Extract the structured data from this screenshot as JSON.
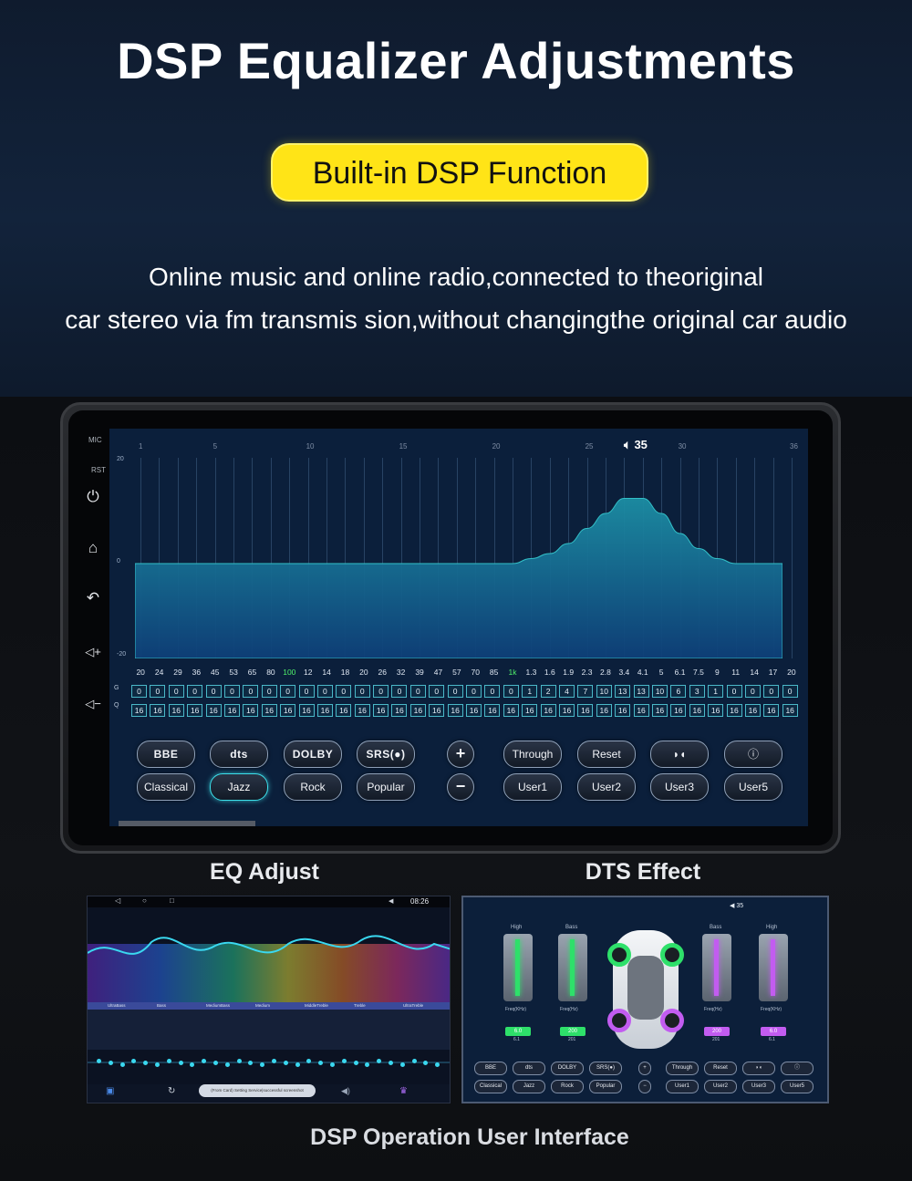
{
  "headline": "DSP Equalizer Adjustments",
  "pill": "Built-in DSP Function",
  "description": {
    "line1": "Online music and online radio,connected to theoriginal",
    "line2": "car stereo via fm transmis sion,without changingthe original car audio"
  },
  "tablet": {
    "side_labels": {
      "mic": "MIC",
      "rst": "RST"
    },
    "side_icons": [
      "power-icon",
      "home-icon",
      "back-icon",
      "volume-up-icon",
      "volume-down-icon"
    ],
    "volume": "35",
    "band_numbers": [
      "1",
      "5",
      "10",
      "15",
      "20",
      "25",
      "30",
      "36"
    ],
    "y_labels": [
      "20",
      "0",
      "-20"
    ],
    "row_labels": {
      "g": "G",
      "q": "Q"
    },
    "frequencies": [
      "20",
      "24",
      "29",
      "36",
      "45",
      "53",
      "65",
      "80",
      "100",
      "12",
      "14",
      "18",
      "20",
      "26",
      "32",
      "39",
      "47",
      "57",
      "70",
      "85",
      "1k",
      "1.3",
      "1.6",
      "1.9",
      "2.3",
      "2.8",
      "3.4",
      "4.1",
      "5",
      "6.1",
      "7.5",
      "9",
      "11",
      "14",
      "17",
      "20"
    ],
    "gains": [
      "0",
      "0",
      "0",
      "0",
      "0",
      "0",
      "0",
      "0",
      "0",
      "0",
      "0",
      "0",
      "0",
      "0",
      "0",
      "0",
      "0",
      "0",
      "0",
      "0",
      "0",
      "1",
      "2",
      "4",
      "7",
      "10",
      "13",
      "13",
      "10",
      "6",
      "3",
      "1",
      "0",
      "0",
      "0",
      "0"
    ],
    "q_values": [
      "16",
      "16",
      "16",
      "16",
      "16",
      "16",
      "16",
      "16",
      "16",
      "16",
      "16",
      "16",
      "16",
      "16",
      "16",
      "16",
      "16",
      "16",
      "16",
      "16",
      "16",
      "16",
      "16",
      "16",
      "16",
      "16",
      "16",
      "16",
      "16",
      "16",
      "16",
      "16",
      "16",
      "16",
      "16",
      "16"
    ],
    "buttons_row1": [
      "BBE",
      "dts",
      "DOLBY",
      "SRS(●)",
      "+",
      "Through",
      "Reset",
      "◗◖",
      "ⓘ"
    ],
    "buttons_row2": [
      "Classical",
      "Jazz",
      "Rock",
      "Popular",
      "−",
      "User1",
      "User2",
      "User3",
      "User5"
    ],
    "active_preset": "Jazz",
    "colors": {
      "accent": "#3de0ea",
      "curve_fill": "#1f8fa6",
      "screen_bg": "#0b1f3b"
    }
  },
  "captions": {
    "eq_adjust": "EQ Adjust",
    "dts_effect": "DTS Effect",
    "footer": "DSP Operation User Interface"
  },
  "mini_left": {
    "clock": "08:26",
    "bands": [
      "UltraBass",
      "Bass",
      "MediumBass",
      "Medium",
      "MiddleTreble",
      "Treble",
      "UltraTreble"
    ],
    "toast": "(From Card) Setting Service|successful screenshot"
  },
  "mini_right": {
    "volume": "35",
    "sliders": [
      {
        "label": "High",
        "freq_label": "Freq(KHz)",
        "value": "6.0",
        "sub": "6.1",
        "color": "#2ee06a"
      },
      {
        "label": "Bass",
        "freq_label": "Freq(Hz)",
        "value": "200",
        "sub": "201",
        "color": "#2ee06a"
      },
      {
        "label": "Bass",
        "freq_label": "Freq(Hz)",
        "value": "200",
        "sub": "201",
        "color": "#c25cf0"
      },
      {
        "label": "High",
        "freq_label": "Freq(KHz)",
        "value": "6.0",
        "sub": "6.1",
        "color": "#c25cf0"
      }
    ],
    "buttons_row1": [
      "BBE",
      "dts",
      "DOLBY",
      "SRS(●)",
      "+",
      "Through",
      "Reset",
      "◗◖",
      "ⓘ"
    ],
    "buttons_row2": [
      "Classical",
      "Jazz",
      "Rock",
      "Popular",
      "−",
      "User1",
      "User2",
      "User3",
      "User5"
    ]
  }
}
